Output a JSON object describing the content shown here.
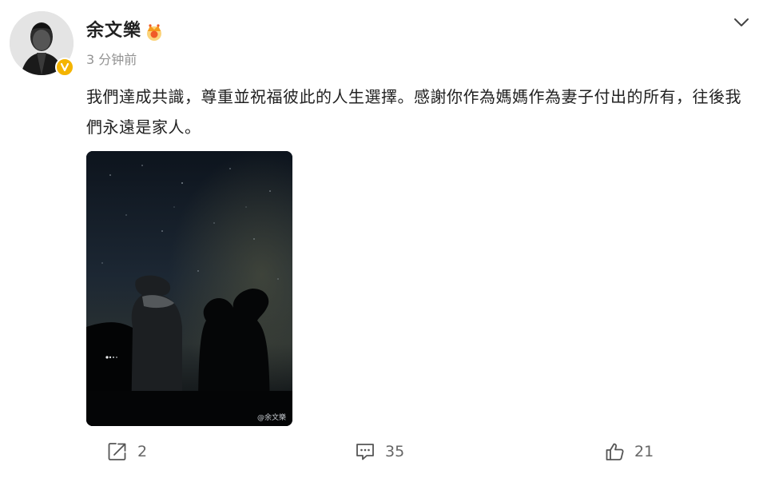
{
  "post": {
    "author": "余文樂",
    "time": "3 分钟前",
    "text": "我們達成共識，尊重並祝福彼此的人生選擇。感謝你作為媽媽作為妻子付出的所有，往後我們永遠是家人。",
    "image_watermark": "@余文樂"
  },
  "actions": {
    "share_count": "2",
    "comment_count": "35",
    "like_count": "21"
  },
  "colors": {
    "verified_badge": "#f4b400",
    "muted_text": "#939393",
    "body_text": "#222222"
  },
  "icons": {
    "verified": "verified-v-icon",
    "vip": "crown-icon",
    "more": "chevron-down-icon",
    "share": "share-icon",
    "comment": "comment-icon",
    "like": "thumbs-up-icon"
  }
}
